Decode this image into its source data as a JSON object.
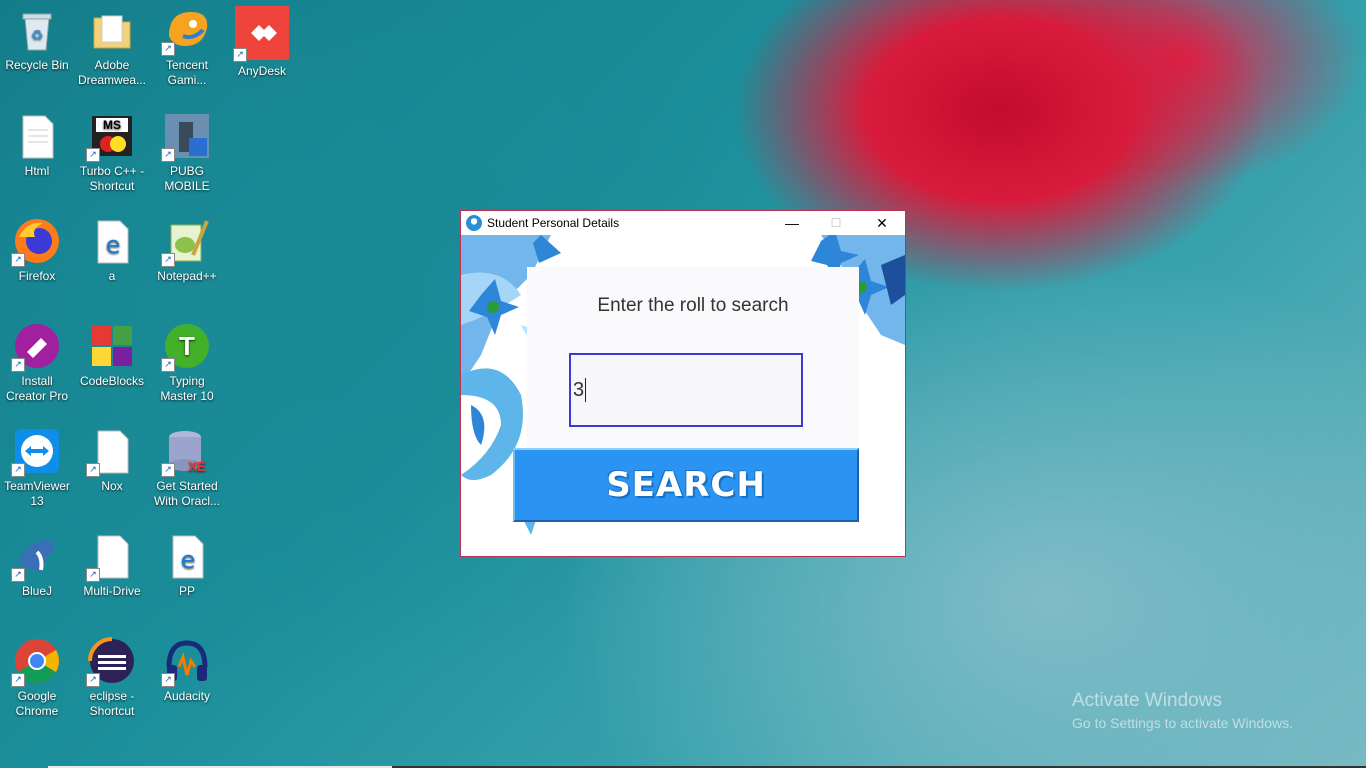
{
  "desktop_icons": [
    {
      "label": "Recycle Bin"
    },
    {
      "label": "Adobe Dreamwea..."
    },
    {
      "label": "Tencent Gami..."
    },
    {
      "label": "AnyDesk"
    },
    {
      "label": "Html"
    },
    {
      "label": "Turbo C++ - Shortcut"
    },
    {
      "label": "PUBG MOBILE"
    },
    {
      "label": "Firefox"
    },
    {
      "label": "a"
    },
    {
      "label": "Notepad++"
    },
    {
      "label": "Install Creator Pro"
    },
    {
      "label": "CodeBlocks"
    },
    {
      "label": "Typing Master 10"
    },
    {
      "label": "TeamViewer 13"
    },
    {
      "label": "Nox"
    },
    {
      "label": "Get Started With Oracl..."
    },
    {
      "label": "BlueJ"
    },
    {
      "label": "Multi-Drive"
    },
    {
      "label": "PP"
    },
    {
      "label": "Google Chrome"
    },
    {
      "label": "eclipse - Shortcut"
    },
    {
      "label": "Audacity"
    }
  ],
  "window": {
    "title": "Student Personal Details",
    "minimize": "—",
    "maximize": "☐",
    "close": "✕",
    "prompt": "Enter the roll to search",
    "roll_value": "3",
    "search_label": "SEARCH"
  },
  "watermark": {
    "line1": "Activate Windows",
    "line2": "Go to Settings to activate Windows."
  }
}
